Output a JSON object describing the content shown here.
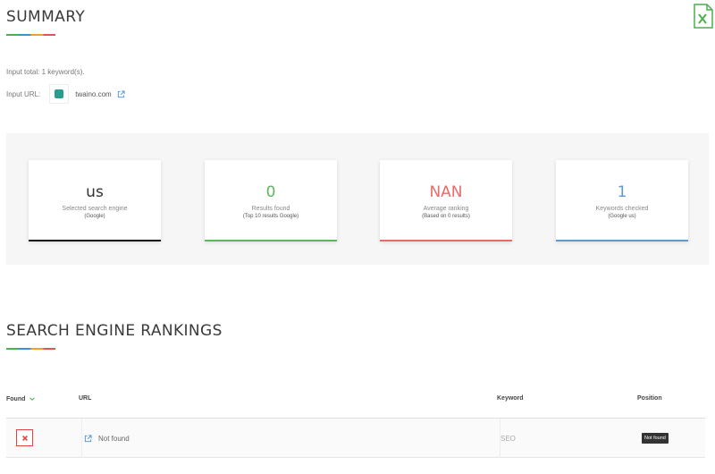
{
  "summary": {
    "title": "SUMMARY",
    "input_total": "Input total: 1 keyword(s).",
    "input_url_label": "Input URL:",
    "domain": "twaino.com"
  },
  "cards": [
    {
      "value": "us",
      "label": "Selected search engine",
      "sublabel": "(Google)",
      "color": "#333333",
      "bar_color": "#111111"
    },
    {
      "value": "0",
      "label": "Results found",
      "sublabel": "(Top 10 results Google)",
      "color": "#5cb85c",
      "bar_color": "#5cb85c"
    },
    {
      "value": "NAN",
      "label": "Average ranking",
      "sublabel": "(Based on 0 results)",
      "color": "#e86a6a",
      "bar_color": "#e86a6a"
    },
    {
      "value": "1",
      "label": "Keywords checked",
      "sublabel": "(Google us)",
      "color": "#5b9bd5",
      "bar_color": "#5b9bd5"
    }
  ],
  "rankings": {
    "title": "SEARCH ENGINE RANKINGS",
    "columns": {
      "found": "Found",
      "url": "URL",
      "keyword": "Keyword",
      "position": "Position"
    },
    "rows": [
      {
        "url": "Not found",
        "keyword": "SEO",
        "position": "Not found"
      }
    ]
  },
  "icons": {
    "export": "excel-export-icon",
    "external": "external-link-icon",
    "sort": "chevron-down-icon",
    "not_found": "close-icon"
  },
  "colors": {
    "excel_green": "#4caf50",
    "not_found_red": "#e04444"
  }
}
